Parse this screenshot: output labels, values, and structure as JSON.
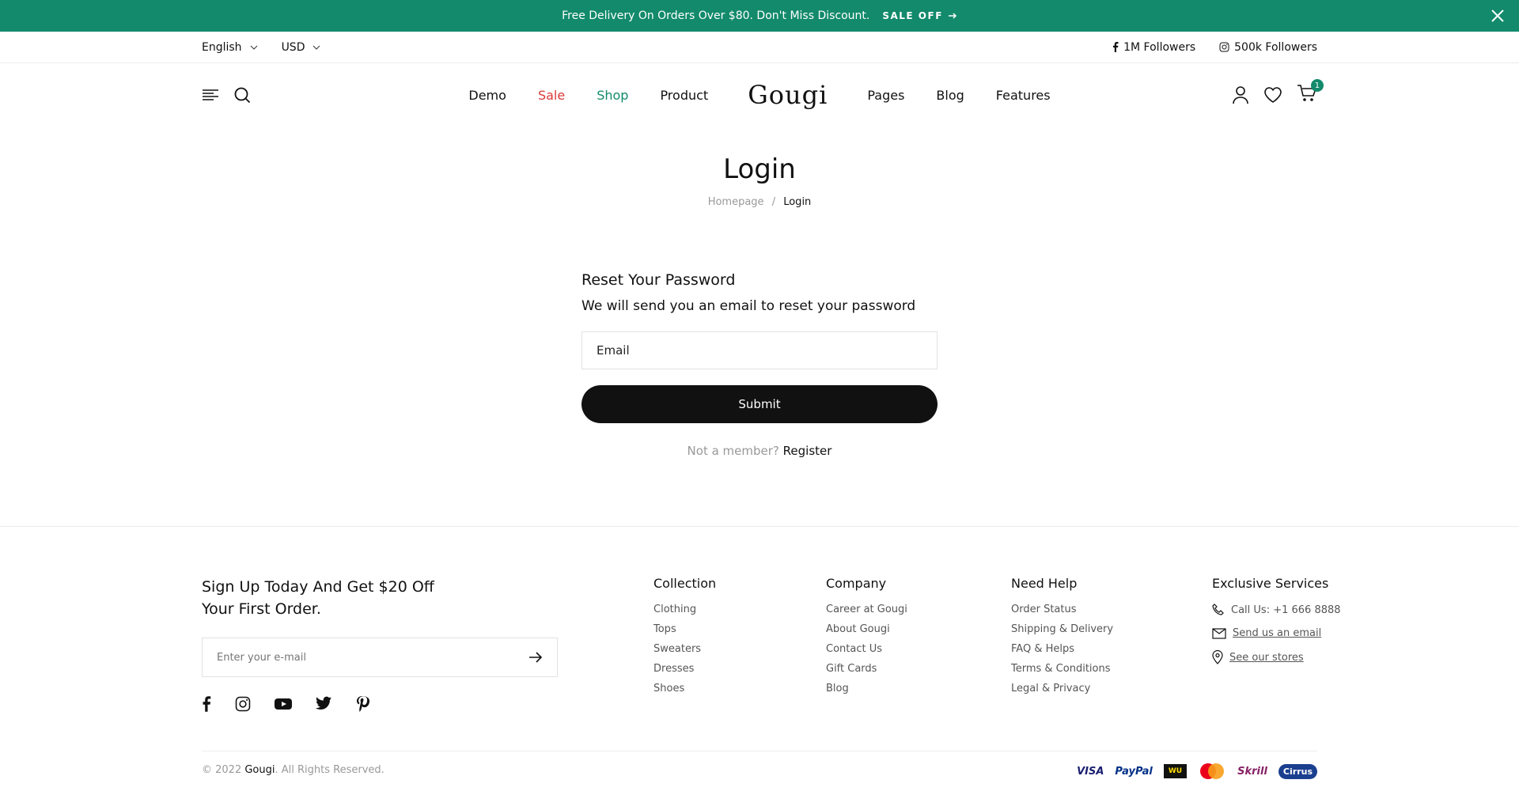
{
  "announcement": {
    "text": "Free Delivery On Orders Over $80. Don't Miss Discount.",
    "sale_label": "SALE OFF"
  },
  "topbar": {
    "language": "English",
    "currency": "USD",
    "facebook_followers": "1M Followers",
    "instagram_followers": "500k Followers"
  },
  "header": {
    "logo": "Gougi",
    "nav_left": [
      "Demo",
      "Sale",
      "Shop",
      "Product"
    ],
    "nav_right": [
      "Pages",
      "Blog",
      "Features"
    ],
    "cart_count": "1"
  },
  "page": {
    "title": "Login",
    "breadcrumb_home": "Homepage",
    "breadcrumb_sep": "/",
    "breadcrumb_current": "Login"
  },
  "form": {
    "heading": "Reset Your Password",
    "description": "We will send you an email to reset your password",
    "email_placeholder": "Email",
    "submit_label": "Submit",
    "member_text": "Not a member?",
    "register_label": "Register"
  },
  "footer": {
    "signup_title": "Sign Up Today And Get $20 Off Your First Order.",
    "newsletter_placeholder": "Enter your e-mail",
    "collection": {
      "title": "Collection",
      "items": [
        "Clothing",
        "Tops",
        "Sweaters",
        "Dresses",
        "Shoes"
      ]
    },
    "company": {
      "title": "Company",
      "items": [
        "Career at Gougi",
        "About Gougi",
        "Contact Us",
        "Gift Cards",
        "Blog"
      ]
    },
    "help": {
      "title": "Need Help",
      "items": [
        "Order Status",
        "Shipping & Delivery",
        "FAQ & Helps",
        "Terms & Conditions",
        "Legal & Privacy"
      ]
    },
    "services": {
      "title": "Exclusive Services",
      "call": "Call Us: +1 666 8888",
      "email": "Send us an email",
      "stores": "See our stores"
    },
    "copyright_prefix": "© 2022",
    "copyright_brand": "Gougi",
    "copyright_suffix": ". All Rights Reserved.",
    "payments": [
      "VISA",
      "PayPal",
      "WU",
      "MC",
      "Skrill",
      "Cirrus"
    ]
  },
  "colors": {
    "brand_green": "#128a6b",
    "sale_red": "#db3a3a"
  }
}
